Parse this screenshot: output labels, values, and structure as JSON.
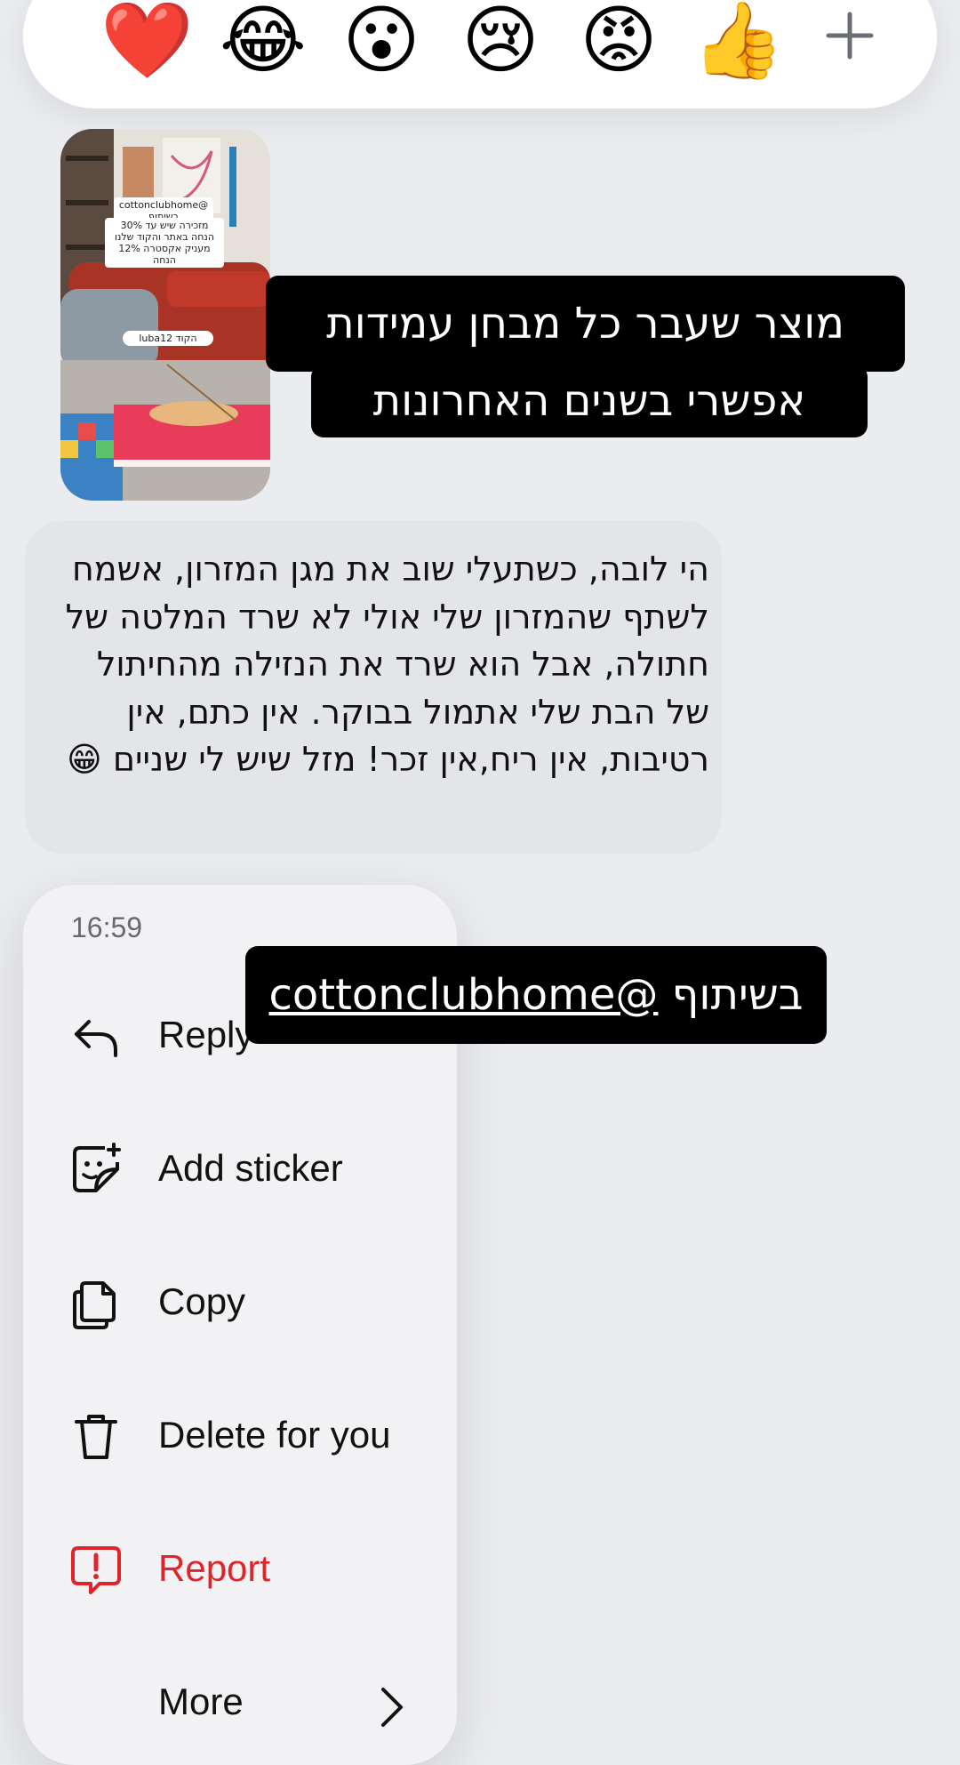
{
  "reactions": {
    "emojis": [
      "❤️",
      "😂",
      "😮",
      "😢",
      "😡",
      "👍"
    ],
    "add_label": "+"
  },
  "story": {
    "notes": [
      "@cottonclubhome בשיתוף",
      "מזכירה שיש עד 30% הנחה באתר והקוד שלנו מעניק אקסטרה 12% הנחה",
      "הקוד luba12"
    ],
    "caption_line1": "מוצר שעבר כל מבחן עמידות",
    "caption_line2": "אפשרי בשנים האחרונות"
  },
  "message": {
    "text": "הי לובה, כשתעלי שוב את מגן המזרון, אשמח לשתף שהמזרון שלי אולי לא שרד המלטה של חתולה, אבל הוא שרד את הנזילה מהחיתול של הבת שלי אתמול בבוקר. אין כתם, אין רטיבות, אין ריח,אין זכר! מזל שיש לי שניים 😁"
  },
  "menu": {
    "time": "16:59",
    "items": [
      {
        "label": "Reply",
        "icon": "reply-icon"
      },
      {
        "label": "Add sticker",
        "icon": "sticker-icon"
      },
      {
        "label": "Copy",
        "icon": "copy-icon"
      },
      {
        "label": "Delete for you",
        "icon": "trash-icon"
      },
      {
        "label": "Report",
        "icon": "report-icon"
      },
      {
        "label": "More",
        "icon": "chevron-right-icon"
      }
    ]
  },
  "overlay_tag": {
    "prefix": "בשיתוף ",
    "handle": "cottonclubhome@"
  },
  "colors": {
    "background": "#ebecef",
    "danger": "#e0242b",
    "caption_bg": "#000000"
  }
}
